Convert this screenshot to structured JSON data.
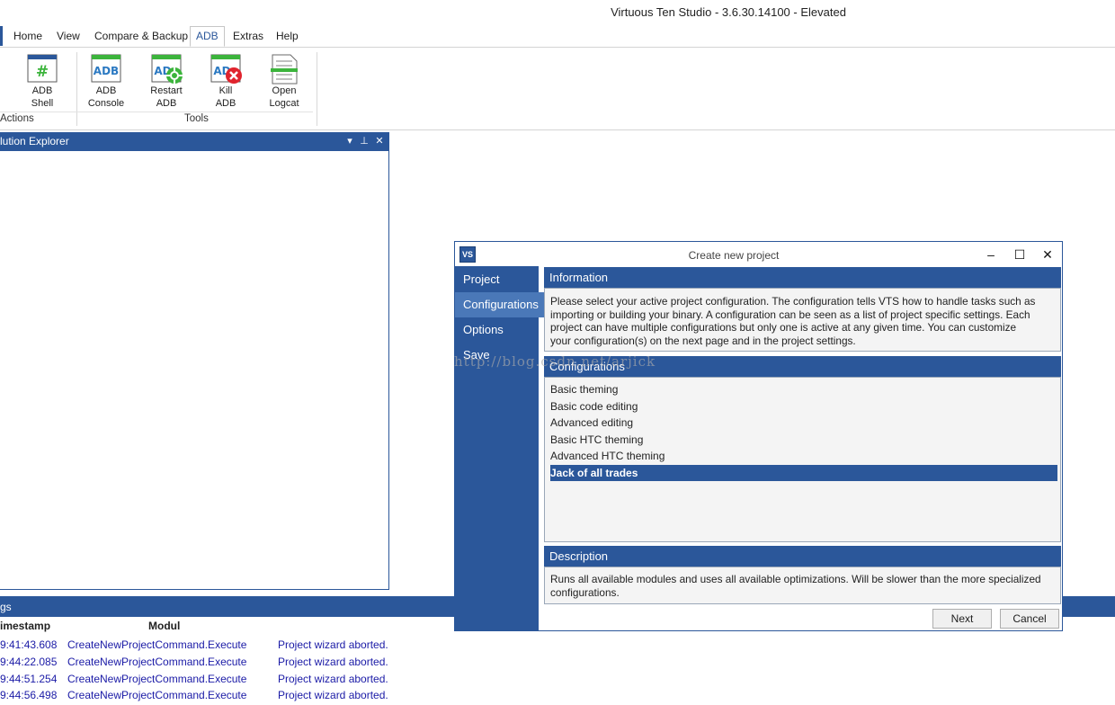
{
  "app": {
    "title": "Virtuous Ten Studio - 3.6.30.14100 - Elevated"
  },
  "menu": [
    {
      "label": "Home"
    },
    {
      "label": "View"
    },
    {
      "label": "Compare & Backup"
    },
    {
      "label": "ADB",
      "active": true
    },
    {
      "label": "Extras"
    },
    {
      "label": "Help"
    }
  ],
  "ribbon": {
    "buttons": [
      {
        "label1": "ADB",
        "label2": "Shell",
        "icon": "adb-shell-icon"
      },
      {
        "label1": "ADB",
        "label2": "Console",
        "icon": "adb-console-icon"
      },
      {
        "label1": "Restart",
        "label2": "ADB",
        "icon": "restart-adb-icon"
      },
      {
        "label1": "Kill",
        "label2": "ADB",
        "icon": "kill-adb-icon"
      },
      {
        "label1": "Open",
        "label2": "Logcat",
        "icon": "open-logcat-icon"
      }
    ],
    "groups": [
      "Actions",
      "Tools"
    ],
    "icon_text": {
      "shell": "#",
      "adb": "ADB",
      "adb_partial": "AD"
    }
  },
  "solution_explorer": {
    "title": "lution Explorer",
    "controls": [
      "▾",
      "⊥",
      "✕"
    ]
  },
  "logs": {
    "title": "gs",
    "columns": [
      "imestamp",
      "Modul"
    ],
    "rows": [
      {
        "time": "9:41:43.608",
        "module": "CreateNewProjectCommand.Execute",
        "message": "Project wizard aborted."
      },
      {
        "time": "9:44:22.085",
        "module": "CreateNewProjectCommand.Execute",
        "message": "Project wizard aborted."
      },
      {
        "time": "9:44:51.254",
        "module": "CreateNewProjectCommand.Execute",
        "message": "Project wizard aborted."
      },
      {
        "time": "9:44:56.498",
        "module": "CreateNewProjectCommand.Execute",
        "message": "Project wizard aborted."
      }
    ]
  },
  "dialog": {
    "title": "Create new project",
    "icon_text": "VS",
    "controls": {
      "minimize": "–",
      "maximize": "☐",
      "close": "✕"
    },
    "nav": [
      {
        "label": "Project"
      },
      {
        "label": "Configurations",
        "active": true
      },
      {
        "label": "Options"
      },
      {
        "label": "Save"
      }
    ],
    "information": {
      "heading": "Information",
      "lines": [
        "Please select your active project configuration. The configuration tells VTS how to handle tasks such as",
        "importing or building your binary. A configuration can be seen as a list of project specific settings. Each",
        "project can have multiple configurations but only one is active at any given time. You can customize",
        "your configuration(s) on the next page and in the project settings."
      ]
    },
    "configurations": {
      "heading": "Configurations",
      "items": [
        "Basic theming",
        "Basic code editing",
        "Advanced editing",
        "Basic HTC theming",
        "Advanced HTC theming",
        "Jack of all trades"
      ],
      "selected": "Jack of all trades"
    },
    "description": {
      "heading": "Description",
      "lines": [
        "Runs all available modules and uses all available optimizations. Will be slower than the more specialized",
        "configurations."
      ]
    },
    "buttons": {
      "next": "Next",
      "cancel": "Cancel"
    }
  },
  "watermark": "http://blog.csdn.net/arjick",
  "colors": {
    "accent": "#2b579a",
    "nav_active": "#4a78b8",
    "log_text": "#1a1aa6",
    "kill_red": "#e0232d",
    "restart_green": "#3cb43c"
  }
}
